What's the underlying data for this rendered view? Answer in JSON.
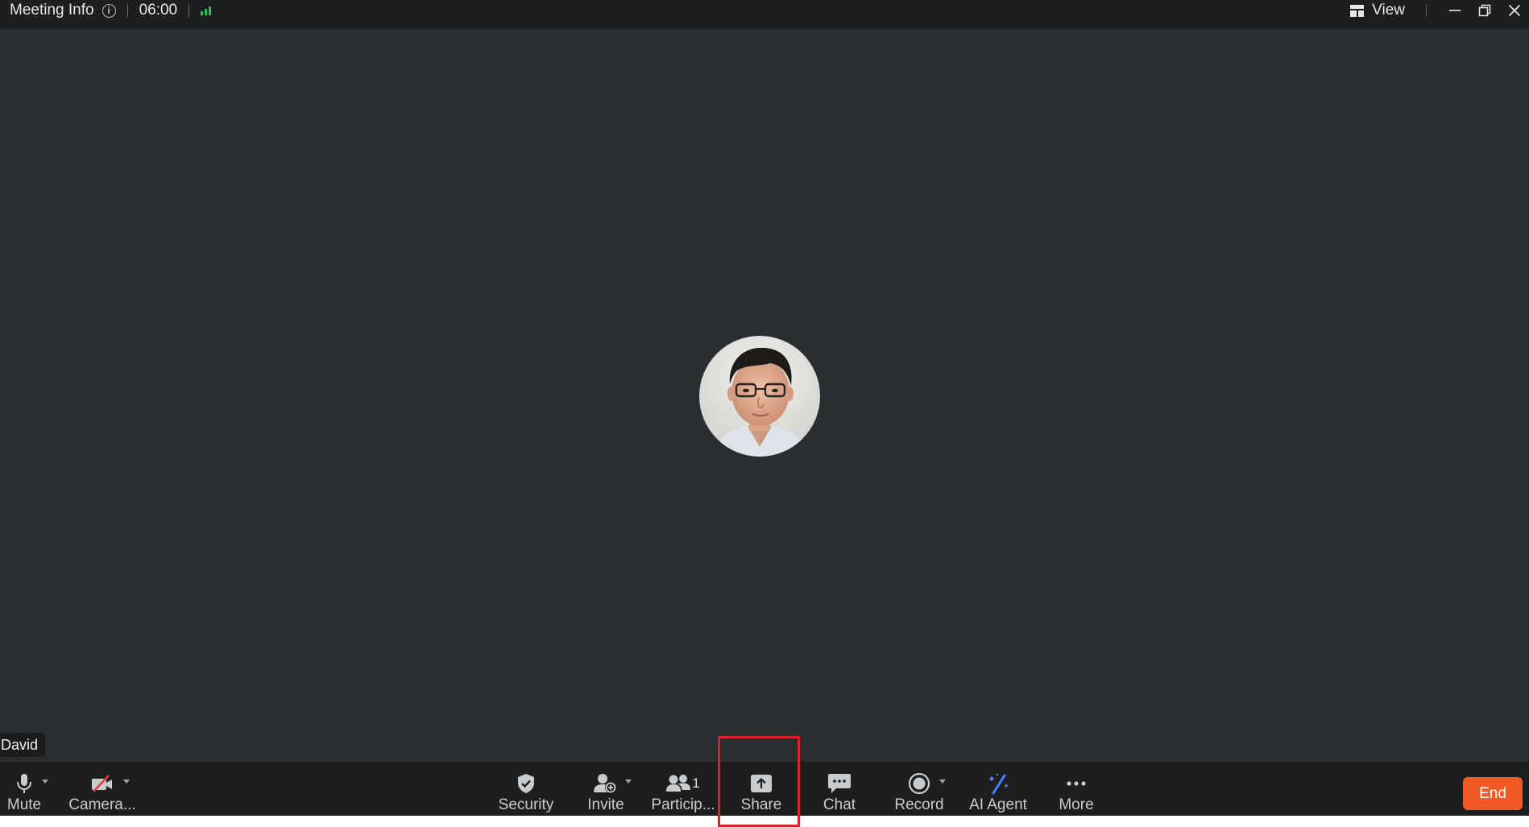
{
  "topbar": {
    "meeting_info": "Meeting Info",
    "timer": "06:00",
    "view_label": "View"
  },
  "participant": {
    "name": "David"
  },
  "toolbar": {
    "mute": "Mute",
    "camera": "Camera...",
    "security": "Security",
    "invite": "Invite",
    "participants": "Particip...",
    "participants_count": "1",
    "share": "Share",
    "chat": "Chat",
    "record": "Record",
    "ai_agent": "AI Agent",
    "more": "More",
    "end": "End"
  },
  "colors": {
    "background": "#2b2e30",
    "bar": "#1c1e20",
    "end_button": "#f15a24",
    "highlight": "#d8232a",
    "signal": "#22c55e"
  }
}
